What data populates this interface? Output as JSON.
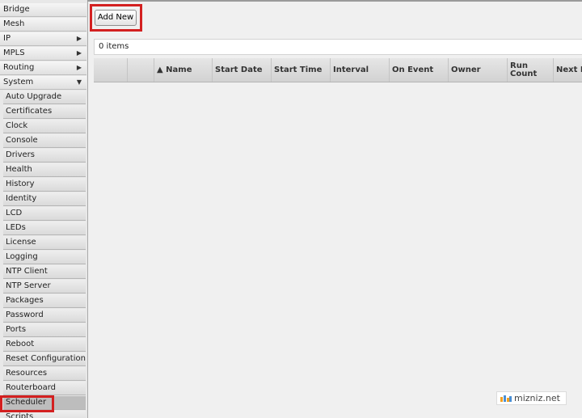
{
  "sidebar": {
    "menu": [
      {
        "label": "Bridge",
        "arrow": ""
      },
      {
        "label": "Mesh",
        "arrow": ""
      },
      {
        "label": "IP",
        "arrow": "▶"
      },
      {
        "label": "MPLS",
        "arrow": "▶"
      },
      {
        "label": "Routing",
        "arrow": "▶"
      },
      {
        "label": "System",
        "arrow": "▼"
      }
    ],
    "system_items": [
      "Auto Upgrade",
      "Certificates",
      "Clock",
      "Console",
      "Drivers",
      "Health",
      "History",
      "Identity",
      "LCD",
      "LEDs",
      "License",
      "Logging",
      "NTP Client",
      "NTP Server",
      "Packages",
      "Password",
      "Ports",
      "Reboot",
      "Reset Configuration",
      "Resources",
      "Routerboard",
      "Scheduler",
      "Scripts"
    ],
    "active_item": "Scheduler"
  },
  "toolbar": {
    "add_new_label": "Add New"
  },
  "items_count": "0 items",
  "table": {
    "columns": [
      "",
      "",
      "▲ Name",
      "Start Date",
      "Start Time",
      "Interval",
      "On Event",
      "Owner",
      "Run Count",
      "Next Run"
    ]
  },
  "watermark": "mizniz.net",
  "colors": {
    "highlight": "#d32020",
    "active_item_bg": "#bdbdbd"
  }
}
